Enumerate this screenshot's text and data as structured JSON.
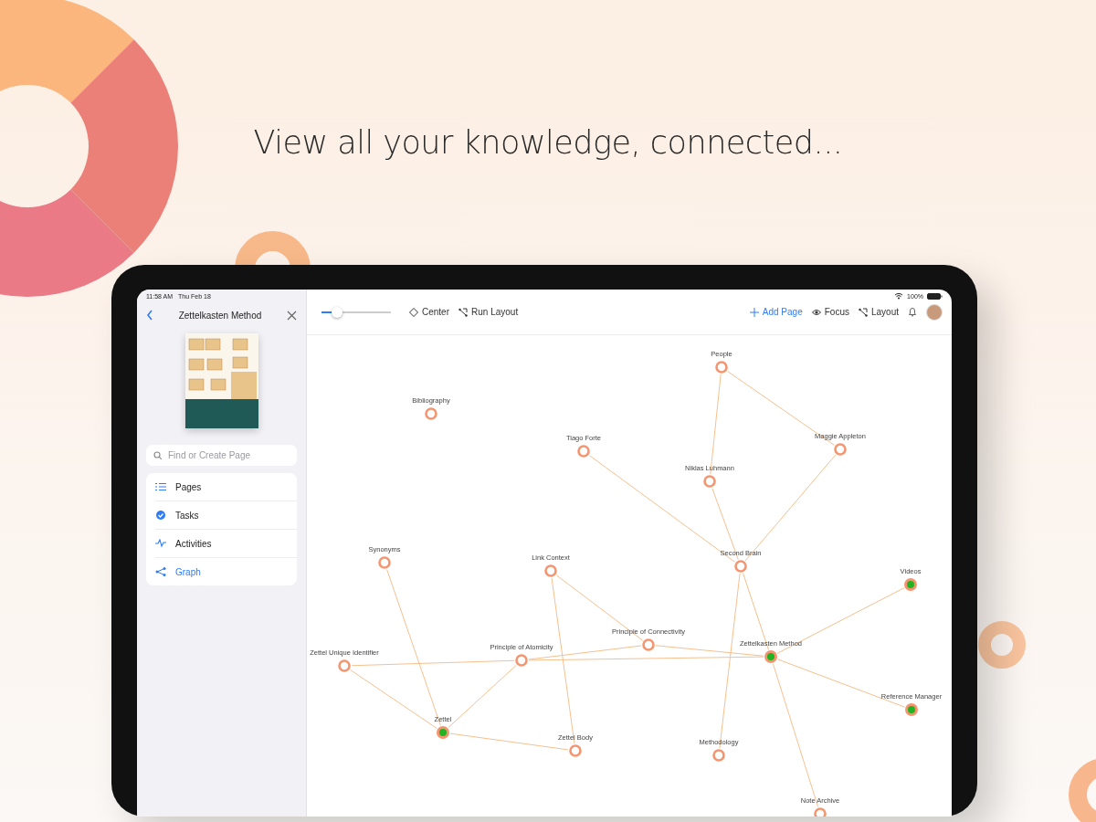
{
  "headline": "View all your knowledge, connected...",
  "status_bar": {
    "time": "11:58 AM",
    "date": "Thu Feb 18",
    "battery": "100%"
  },
  "sidebar": {
    "title": "Zettelkasten Method",
    "search": {
      "placeholder": "Find or Create Page"
    },
    "items": [
      {
        "label": "Pages",
        "selected": false
      },
      {
        "label": "Tasks",
        "selected": false
      },
      {
        "label": "Activities",
        "selected": false
      },
      {
        "label": "Graph",
        "selected": true
      }
    ]
  },
  "toolbar": {
    "zoom": {
      "level": 0.22
    },
    "left_buttons": [
      "Center",
      "Run Layout"
    ],
    "add_page": "Add Page",
    "right_buttons": [
      "Focus",
      "Layout"
    ]
  },
  "graph": {
    "nodes": [
      {
        "label": "People",
        "filled": false
      },
      {
        "label": "Bibliography",
        "filled": false
      },
      {
        "label": "Tiago Forte",
        "filled": false
      },
      {
        "label": "Maggie Appleton",
        "filled": false
      },
      {
        "label": "Niklas Luhmann",
        "filled": false
      },
      {
        "label": "Second Brain",
        "filled": false
      },
      {
        "label": "Synonyms",
        "filled": false
      },
      {
        "label": "Link Context",
        "filled": false
      },
      {
        "label": "Videos",
        "filled": true
      },
      {
        "label": "Principle of Connectivity",
        "filled": false
      },
      {
        "label": "Principle of Atomicity",
        "filled": false
      },
      {
        "label": "Zettel Unique Identifier",
        "filled": false
      },
      {
        "label": "Zettelkasten Method",
        "filled": true
      },
      {
        "label": "Reference Manager",
        "filled": true
      },
      {
        "label": "Zettel",
        "filled": true
      },
      {
        "label": "Zettel Body",
        "filled": false
      },
      {
        "label": "Methodology",
        "filled": false
      },
      {
        "label": "Note Archive",
        "filled": false
      }
    ]
  }
}
